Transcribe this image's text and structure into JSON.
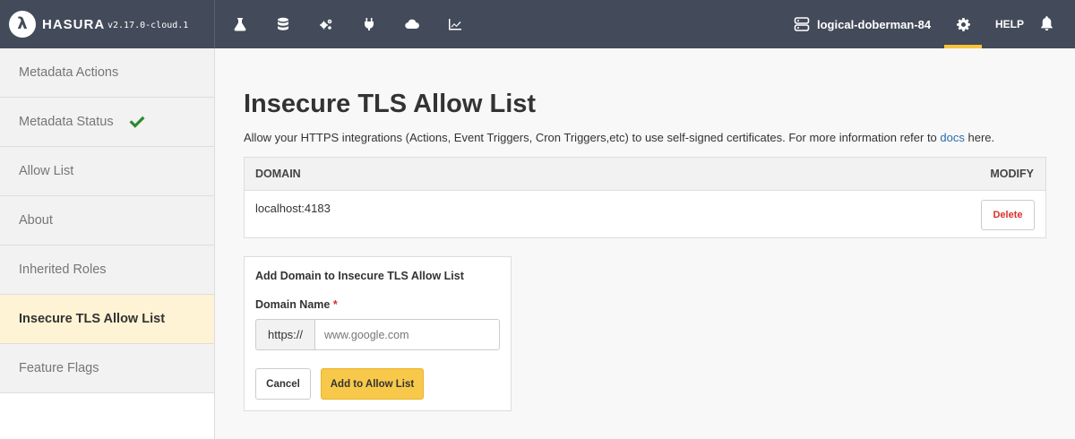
{
  "header": {
    "brand_logo_letter": "λ",
    "brand_name": "HASURA",
    "version": "v2.17.0-cloud.1",
    "nav_icons": [
      "flask-icon",
      "database-icon",
      "gears-icon",
      "plug-icon",
      "cloud-icon",
      "chart-icon"
    ],
    "project_name": "logical-doberman-84",
    "help_label": "HELP",
    "accent_color": "#f8c43a"
  },
  "sidebar": {
    "items": [
      {
        "label": "Metadata Actions"
      },
      {
        "label": "Metadata Status"
      },
      {
        "label": "Allow List"
      },
      {
        "label": "About"
      },
      {
        "label": "Inherited Roles"
      },
      {
        "label": "Insecure TLS Allow List"
      },
      {
        "label": "Feature Flags"
      }
    ],
    "active_item": "Insecure TLS Allow List"
  },
  "main": {
    "title": "Insecure TLS Allow List",
    "description_before": "Allow your HTTPS integrations (Actions, Event Triggers, Cron Triggers,etc) to use self-signed certificates. For more information refer to ",
    "description_link": "docs",
    "description_after": " here.",
    "table": {
      "headers": [
        "DOMAIN",
        "MODIFY"
      ],
      "rows": [
        {
          "domain": "localhost:4183",
          "action": "Delete"
        }
      ]
    },
    "form": {
      "title": "Add Domain to Insecure TLS Allow List",
      "field_label": "Domain Name",
      "required_mark": "*",
      "prefix": "https://",
      "placeholder": "www.google.com",
      "value": "",
      "cancel_label": "Cancel",
      "submit_label": "Add to Allow List"
    }
  }
}
